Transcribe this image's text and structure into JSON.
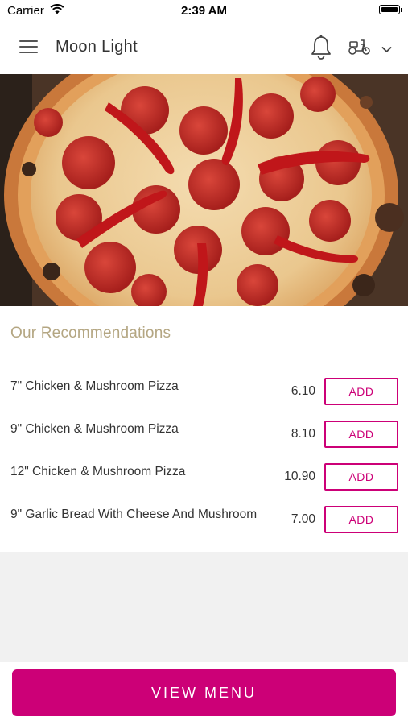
{
  "status_bar": {
    "carrier": "Carrier",
    "time": "2:39 AM"
  },
  "header": {
    "brand": "Moon Light",
    "icons": [
      "menu-icon",
      "bell-icon",
      "scooter-icon",
      "chevron-down-icon"
    ]
  },
  "recommendations": {
    "title": "Our Recommendations",
    "items": [
      {
        "name": "7\" Chicken & Mushroom Pizza",
        "price": "6.10",
        "add_label": "ADD"
      },
      {
        "name": "9\" Chicken & Mushroom Pizza",
        "price": "8.10",
        "add_label": "ADD"
      },
      {
        "name": "12\" Chicken & Mushroom Pizza",
        "price": "10.90",
        "add_label": "ADD"
      },
      {
        "name": "9\" Garlic Bread With Cheese And Mushroom",
        "price": "7.00",
        "add_label": "ADD"
      }
    ]
  },
  "footer": {
    "view_menu_label": "VIEW MENU"
  },
  "colors": {
    "accent": "#cc0077",
    "section_title": "#b4a682"
  }
}
